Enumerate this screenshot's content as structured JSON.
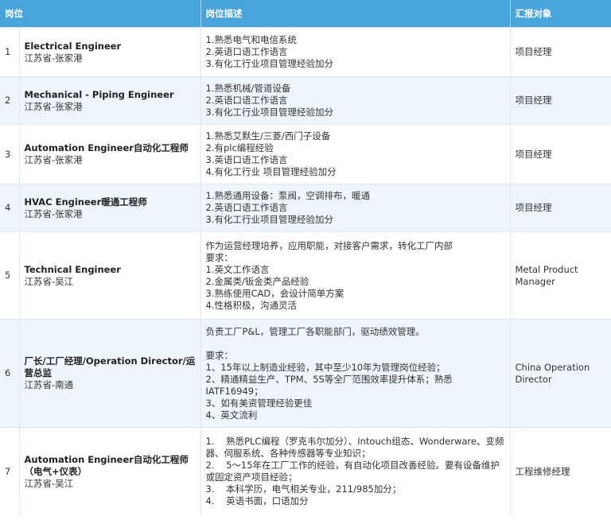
{
  "headers": {
    "position": "岗位",
    "description": "岗位描述",
    "reports_to": "汇报对象"
  },
  "rows": [
    {
      "num": "1",
      "title": "Electrical Engineer",
      "location": "江苏省-张家港",
      "desc": [
        "1.熟悉电气和电信系统",
        "2.英语口语工作语言",
        "3.有化工行业项目管理经验加分"
      ],
      "reports": "项目经理"
    },
    {
      "num": "2",
      "title": "Mechanical - Piping Engineer",
      "location": "江苏省-张家港",
      "desc": [
        "1.熟悉机械/管道设备",
        "2.英语口语工作语言",
        "3.有化工行业项目管理经验加分"
      ],
      "reports": "项目经理"
    },
    {
      "num": "3",
      "title": "Automation Engineer自动化工程师",
      "location": "江苏省-张家港",
      "desc": [
        "1.熟悉艾默生/三菱/西门子设备",
        "2.有plc编程经验",
        "3.英语口语工作语言",
        "4.有化工行业 项目管理经验加分"
      ],
      "reports": "项目经理"
    },
    {
      "num": "4",
      "title": "HVAC Engineer暖通工程师",
      "location": "江苏省-张家港",
      "desc": [
        "1.熟悉通用设备：泵阀，空调排布，暖通",
        "2.英语口语工作语言",
        "3.有化工行业项目管理经验加分"
      ],
      "reports": "项目经理"
    },
    {
      "num": "5",
      "title": "Technical Engineer",
      "location": "江苏省-吴江",
      "desc": [
        "作为运营经理培养，应用职能，对接客户需求，转化工厂内部",
        "要求：",
        "1.英文工作语言",
        "2.金属类/钣金类产品经验",
        "3.熟练使用CAD，会设计简单方案",
        "4.性格积极，沟通灵活"
      ],
      "reports": "Metal Product Manager"
    },
    {
      "num": "6",
      "title": "厂长/工厂经理/Operation Director/运营总监",
      "location": "江苏省-南通",
      "desc": [
        "负责工厂P&L，管理工厂各职能部门，驱动绩效管理。",
        "",
        "要求：",
        "1、15年以上制造业经验，其中至少10年为管理岗位经验；",
        "2、精通精益生产、TPM、5S等全厂范围效率提升体系；熟悉IATF16949；",
        "3、如有美资管理经验更佳",
        "4、英文流利"
      ],
      "reports": "China Operation Director"
    },
    {
      "num": "7",
      "title": "Automation Engineer自动化工程师（电气+仪表）",
      "location": "江苏省-吴江",
      "desc": [
        "1.    熟悉PLC编程（罗克韦尔加分）、Intouch组态、Wonderware、变频器、伺服系统、各种传感器等专业知识；",
        "2.    5～15年在工厂工作的经验，有自动化项目改善经验。要有设备维护或固定资产项目经验；",
        "3.    本科学历，电气相关专业，211/985加分；",
        "4.    英语书面，口语加分"
      ],
      "reports": "工程维修经理"
    }
  ]
}
